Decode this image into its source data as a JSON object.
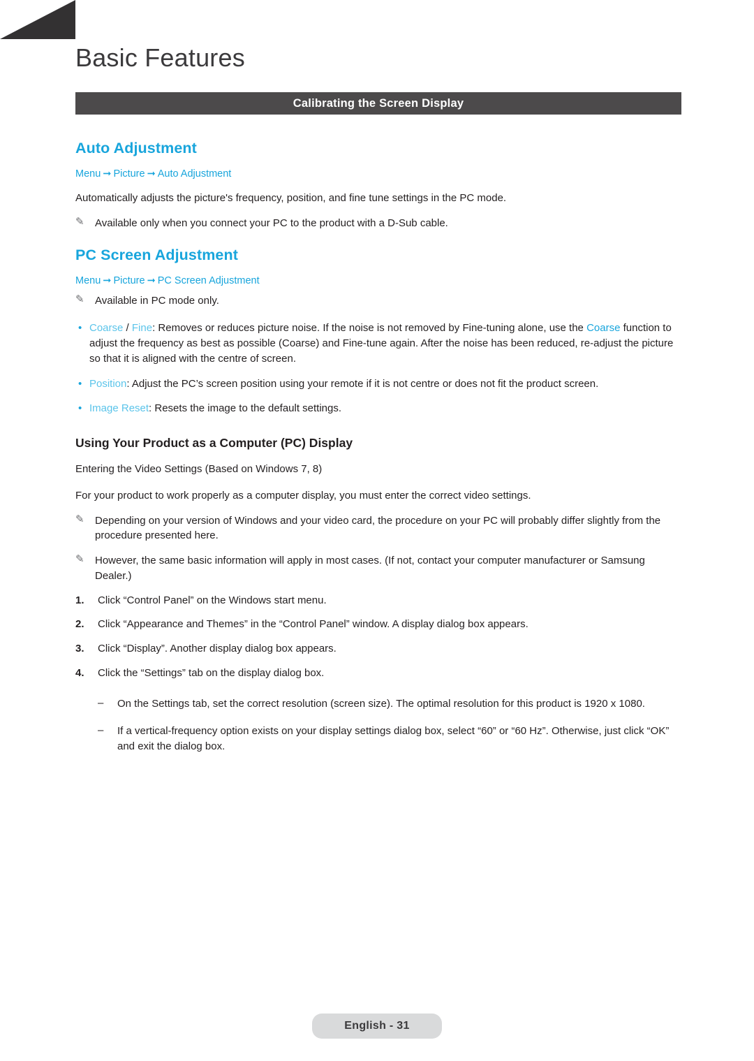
{
  "page": {
    "chapter_title": "Basic Features",
    "section_bar": "Calibrating the Screen Display",
    "footer": "English - 31"
  },
  "auto_adjustment": {
    "heading": "Auto Adjustment",
    "path": {
      "menu": "Menu",
      "picture": "Picture",
      "item": "Auto Adjustment"
    },
    "body": "Automatically adjusts the picture's frequency, position, and fine tune settings in the PC mode.",
    "note": "Available only when you connect your PC to the product with a D-Sub cable."
  },
  "pc_screen_adjustment": {
    "heading": "PC Screen Adjustment",
    "path": {
      "menu": "Menu",
      "picture": "Picture",
      "item": "PC Screen Adjustment"
    },
    "note": "Available in PC mode only.",
    "bullets": [
      {
        "kw1": "Coarse",
        "sep": " / ",
        "kw2": "Fine",
        "text_a": ": Removes or reduces picture noise. If the noise is not removed by Fine-tuning alone, use the ",
        "kw3": "Coarse",
        "text_b": " function to adjust the frequency as best as possible (Coarse) and Fine-tune again. After the noise has been reduced, re-adjust the picture so that it is aligned with the centre of screen."
      },
      {
        "kw1": "Position",
        "text_a": ": Adjust the PC’s screen position using your remote if it is not centre or does not fit the product screen."
      },
      {
        "kw1": "Image Reset",
        "text_a": ": Resets the image to the default settings."
      }
    ]
  },
  "pc_display": {
    "heading": "Using Your Product as a Computer (PC) Display",
    "subtitle": "Entering the Video Settings (Based on Windows 7, 8)",
    "body": "For your product to work properly as a computer display, you must enter the correct video settings.",
    "notes": [
      "Depending on your version of Windows and your video card, the procedure on your PC will probably differ slightly from the procedure presented here.",
      "However, the same basic information will apply in most cases. (If not, contact your computer manufacturer or Samsung Dealer.)"
    ],
    "steps": [
      {
        "num": "1.",
        "text": "Click “Control Panel” on the Windows start menu."
      },
      {
        "num": "2.",
        "text": "Click “Appearance and Themes” in the “Control Panel” window. A display dialog box appears."
      },
      {
        "num": "3.",
        "text": "Click “Display”. Another display dialog box appears."
      },
      {
        "num": "4.",
        "text": "Click the “Settings” tab on the display dialog box."
      }
    ],
    "sub_steps": [
      "On the Settings tab, set the correct resolution (screen size). The optimal resolution for this product is 1920 x 1080.",
      "If a vertical-frequency option exists on your display settings dialog box, select “60” or “60 Hz”. Otherwise, just click “OK” and exit the dialog box."
    ]
  },
  "icons": {
    "pencil": "pencil-note-icon",
    "arrow": "arrow-right-icon",
    "bullet": "bullet-dot-icon",
    "dash": "dash-icon"
  },
  "colors": {
    "accent": "#18a5dc",
    "accent_light": "#5bc4ea",
    "bar": "#4c4a4b",
    "footer_pill": "#d9dadb",
    "text": "#231f20"
  }
}
